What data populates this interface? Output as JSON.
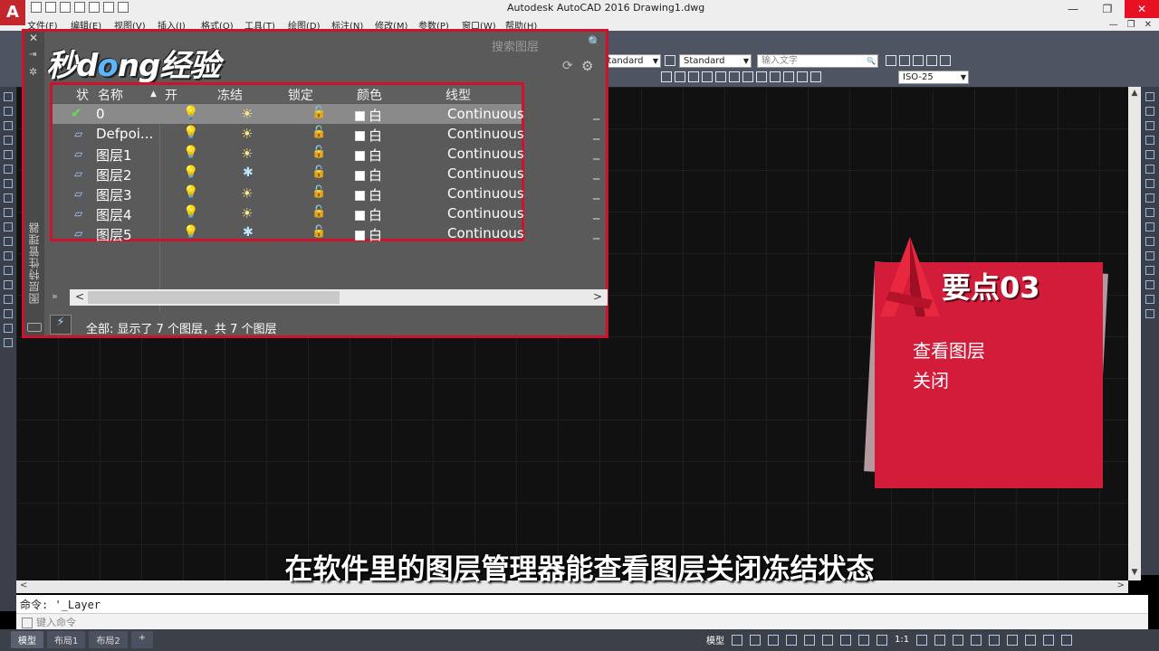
{
  "window": {
    "title": "Autodesk AutoCAD 2016    Drawing1.dwg",
    "controls": [
      "—",
      "❐",
      "✕"
    ],
    "doc_controls": [
      "—",
      "❐",
      "✕"
    ]
  },
  "menubar": [
    "文件(F)",
    "编辑(E)",
    "视图(V)",
    "插入(I)",
    "格式(O)",
    "工具(T)",
    "绘图(D)",
    "标注(N)",
    "修改(M)",
    "参数(P)",
    "窗口(W)",
    "帮助(H)"
  ],
  "toolbar": {
    "text_style": "Standard",
    "table_style": "Standard",
    "search_placeholder": "输入文字",
    "dim_style": "ISO-25"
  },
  "palette": {
    "vertical_title": "图层特性管理器",
    "search_label": "搜索图层",
    "brand": "秒dong经验",
    "columns": {
      "status": "状",
      "name": "名称",
      "on": "开",
      "freeze": "冻结",
      "lock": "锁定",
      "color": "颜色",
      "linetype": "线型"
    },
    "layers": [
      {
        "name": "0",
        "color": "白",
        "linetype": "Continuous",
        "on": true,
        "frozen": false,
        "current": true
      },
      {
        "name": "Defpoi...",
        "color": "白",
        "linetype": "Continuous",
        "on": true,
        "frozen": false,
        "current": false
      },
      {
        "name": "图层1",
        "color": "白",
        "linetype": "Continuous",
        "on": true,
        "frozen": false,
        "current": false
      },
      {
        "name": "图层2",
        "color": "白",
        "linetype": "Continuous",
        "on": true,
        "frozen": true,
        "current": false
      },
      {
        "name": "图层3",
        "color": "白",
        "linetype": "Continuous",
        "on": true,
        "frozen": false,
        "current": false
      },
      {
        "name": "图层4",
        "color": "白",
        "linetype": "Continuous",
        "on": true,
        "frozen": false,
        "current": false
      },
      {
        "name": "图层5",
        "color": "白",
        "linetype": "Continuous",
        "on": true,
        "frozen": true,
        "current": false
      }
    ],
    "status_text": "全部: 显示了 7 个图层，共 7 个图层"
  },
  "command": {
    "history": "命令: '_Layer",
    "placeholder": "键入命令"
  },
  "statusbar": {
    "tabs": [
      "模型",
      "布局1",
      "布局2"
    ],
    "model_label": "模型",
    "scale": "1:1"
  },
  "card": {
    "title": "要点03",
    "line1": "查看图层",
    "line2": "关闭"
  },
  "subtitle": "在软件里的图层管理器能查看图层关闭冻结状态",
  "colors": {
    "accent_red": "#d31c3a",
    "highlight_border": "#d0112b"
  }
}
